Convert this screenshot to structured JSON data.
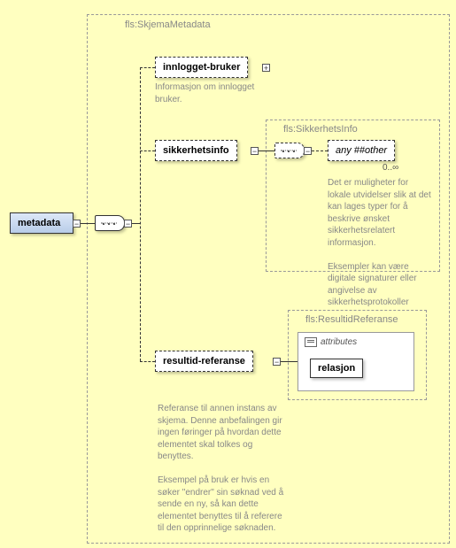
{
  "outer": {
    "label": "fls:SkjemaMetadata"
  },
  "root": {
    "label": "metadata"
  },
  "child1": {
    "label": "innlogget-bruker",
    "desc": "Informasjon om innlogget bruker."
  },
  "child2": {
    "label": "sikkerhetsinfo",
    "type_label": "fls:SikkerhetsInfo",
    "any_label": "any ##other",
    "cardinality": "0..∞",
    "desc": "Det er muligheter for lokale utvidelser slik at det kan lages typer for å beskrive ønsket sikkerhetsrelatert informasjon.\n\n    Eksempler kan være digitale signaturer eller angivelse av sikkerhetsprotokoller"
  },
  "child3": {
    "label": "resultid-referanse",
    "type_label": "fls:ResultidReferanse",
    "attributes_label": "attributes",
    "relasjon_label": "relasjon",
    "desc": "    Referanse til annen instans av skjema. Denne anbefalingen gir ingen føringer på hvordan dette elementet skal tolkes og benyttes.\n\n    Eksempel på bruk er hvis en søker \"endrer\" sin søknad ved å sende en ny, så kan dette elementet benyttes til å referere til den opprinnelige søknaden."
  }
}
